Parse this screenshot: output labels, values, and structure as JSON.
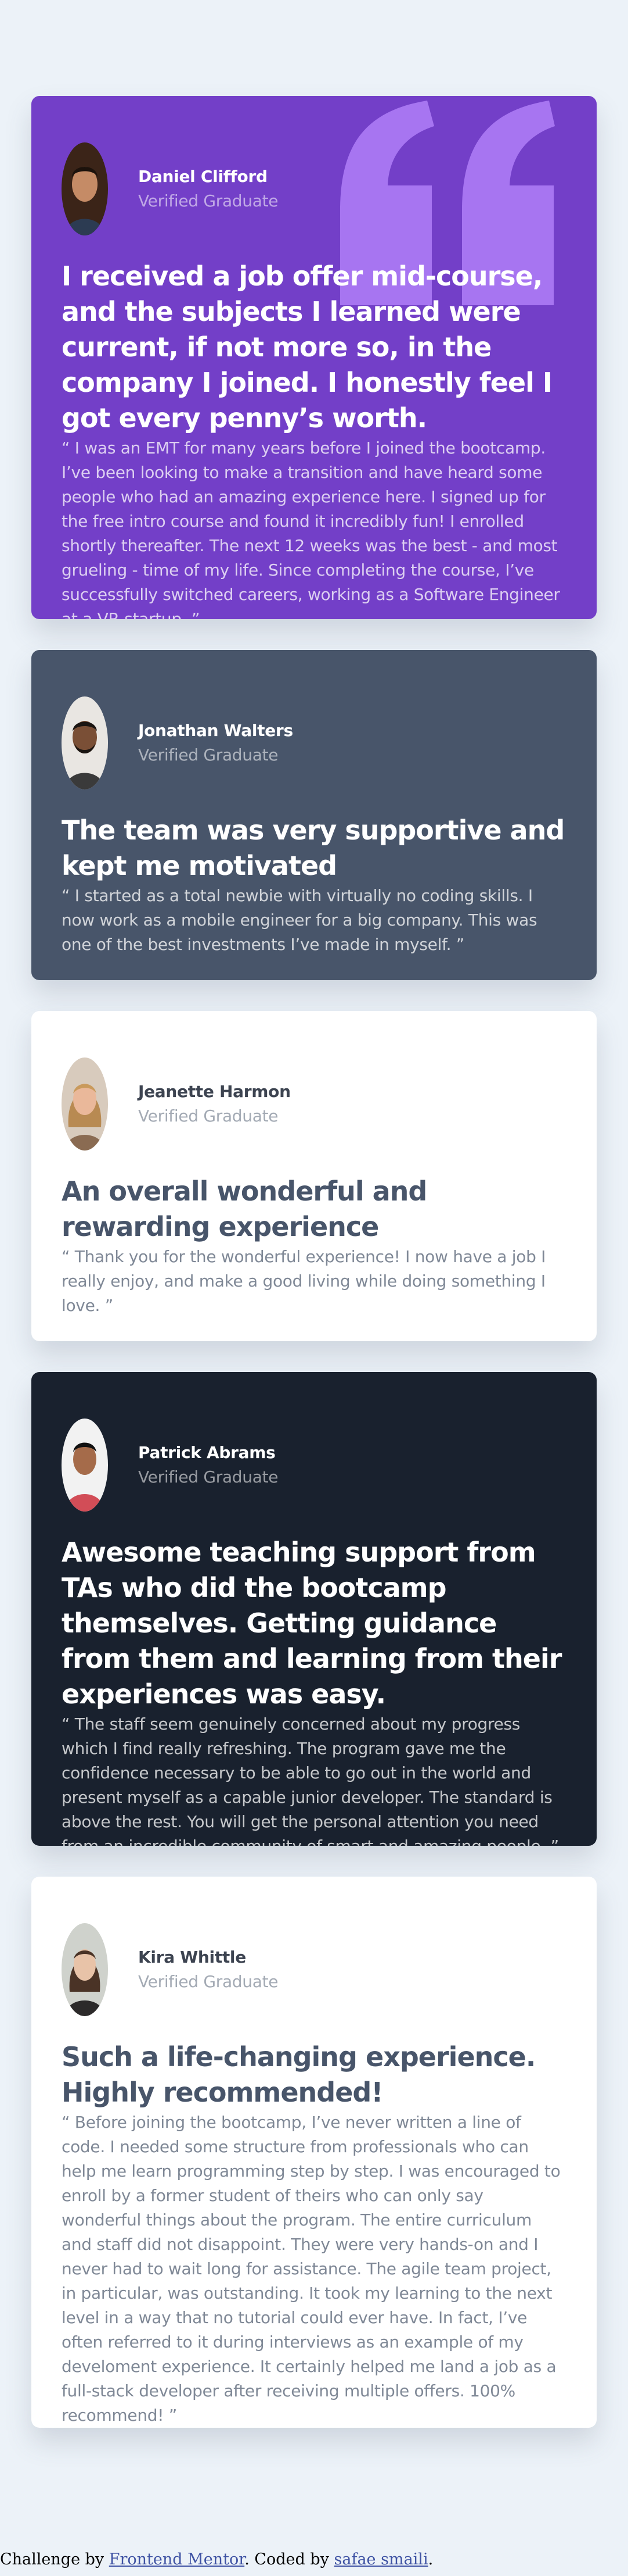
{
  "colors": {
    "page_bg": "#ecf2f8",
    "purple": "#733fc8",
    "slate": "#48556a",
    "white": "#ffffff",
    "dark": "#19212e",
    "quote_mark": "#a775f1",
    "link": "#3e52a3"
  },
  "testimonials": [
    {
      "name": "Daniel Clifford",
      "role": "Verified Graduate",
      "headline": "I received a job offer mid-course, and the subjects I learned were current, if not more so, in the company I joined. I honestly feel I got every penny’s worth.",
      "quote": "“ I was an EMT for many years before I joined the bootcamp. I’ve been looking to make a transition and have heard some people who had an amazing experience here. I signed up for the free intro course and found it incredibly fun! I enrolled shortly thereafter. The next 12 weeks was the best - and most grueling - time of my life. Since completing the course, I’ve successfully switched careers, working as a Software Engineer at a VR startup. ”",
      "avatar_icon": "man-portrait-icon"
    },
    {
      "name": "Jonathan Walters",
      "role": "Verified Graduate",
      "headline": "The team was very supportive and kept me motivated",
      "quote": "“ I started as a total newbie with virtually no coding skills. I now work as a mobile engineer for a big company. This was one of the best investments I’ve made in myself. ”",
      "avatar_icon": "man-portrait-icon"
    },
    {
      "name": "Jeanette Harmon",
      "role": "Verified Graduate",
      "headline": "An overall wonderful and rewarding experience",
      "quote": "“ Thank you for the wonderful experience! I now have a job I really enjoy, and make a good living while doing something I love. ”",
      "avatar_icon": "woman-portrait-icon"
    },
    {
      "name": "Patrick Abrams",
      "role": "Verified Graduate",
      "headline": "Awesome teaching support from TAs who did the bootcamp themselves. Getting guidance from them and learning from their experiences was easy.",
      "quote": "“ The staff seem genuinely concerned about my progress which I find really refreshing. The program gave me the confidence necessary to be able to go out in the world and present myself as a capable junior developer. The standard is above the rest. You will get the personal attention you need from an incredible community of smart and amazing people. ”",
      "avatar_icon": "man-portrait-icon"
    },
    {
      "name": "Kira Whittle",
      "role": "Verified Graduate",
      "headline": "Such a life-changing experience. Highly recommended!",
      "quote": "“ Before joining the bootcamp, I’ve never written a line of code. I needed some structure from professionals who can help me learn programming step by step. I was encouraged to enroll by a former student of theirs who can only say wonderful things about the program. The entire curriculum and staff did not disappoint. They were very hands-on and I never had to wait long for assistance. The agile team project, in particular, was outstanding. It took my learning to the next level in a way that no tutorial could ever have. In fact, I’ve often referred to it during interviews as an example of my develoment experience. It certainly helped me land a job as a full-stack developer after receiving multiple offers. 100% recommend! ”",
      "avatar_icon": "woman-portrait-icon"
    }
  ],
  "attribution": {
    "prefix": "Challenge by ",
    "link1": "Frontend Mentor",
    "middle": ". Coded by ",
    "link2": "safae smaili",
    "suffix": "."
  }
}
